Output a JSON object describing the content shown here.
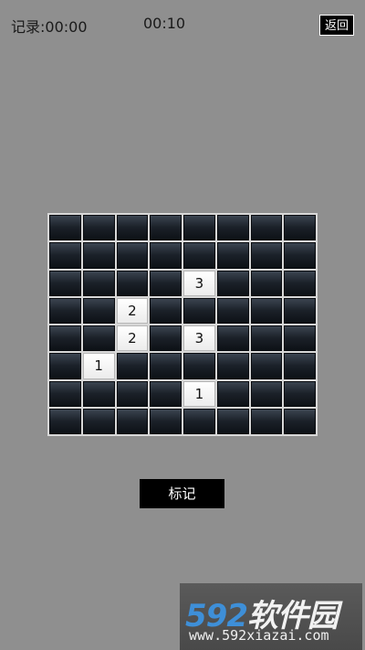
{
  "header": {
    "record_label": "记录:00:00",
    "timer": "00:10",
    "back_label": "返回"
  },
  "board": {
    "rows": 8,
    "cols": 8,
    "cells": [
      [
        "",
        "",
        "",
        "",
        "",
        "",
        "",
        ""
      ],
      [
        "",
        "",
        "",
        "",
        "",
        "",
        "",
        ""
      ],
      [
        "",
        "",
        "",
        "",
        "3",
        "",
        "",
        ""
      ],
      [
        "",
        "",
        "2",
        "",
        "",
        "",
        "",
        ""
      ],
      [
        "",
        "",
        "2",
        "",
        "3",
        "",
        "",
        ""
      ],
      [
        "",
        "1",
        "",
        "",
        "",
        "",
        "",
        ""
      ],
      [
        "",
        "",
        "",
        "",
        "1",
        "",
        "",
        ""
      ],
      [
        "",
        "",
        "",
        "",
        "",
        "",
        "",
        ""
      ]
    ]
  },
  "actions": {
    "mark_label": "标记"
  },
  "watermark": {
    "logo_number": "592",
    "logo_text": "软件园",
    "url": "www.592xiazai.com"
  },
  "colors": {
    "background": "#8f8f8f",
    "hidden_cell_top": "#3b4450",
    "hidden_cell_bottom": "#0d1116",
    "open_cell": "#ffffff",
    "button_bg": "#000000",
    "logo_blue": "#3e8fd8"
  }
}
